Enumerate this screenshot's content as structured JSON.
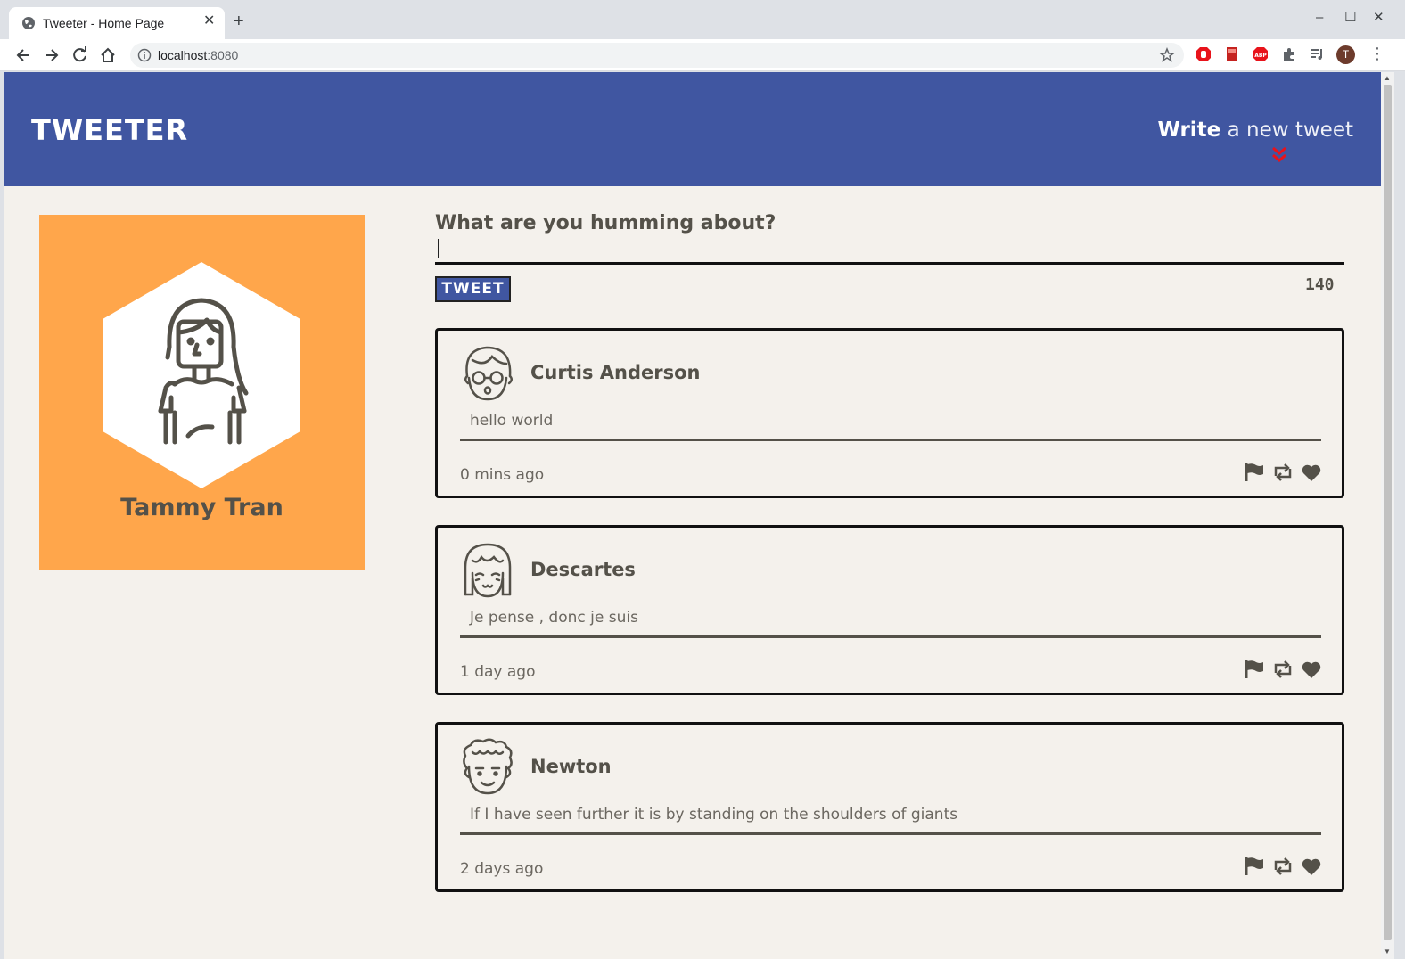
{
  "browser": {
    "tab_title": "Tweeter - Home Page",
    "tab_close": "✕",
    "new_tab": "+",
    "url_host": "localhost",
    "url_port": ":8080",
    "window_controls": [
      "–",
      "☐",
      "✕"
    ],
    "profile_initial": "T",
    "menu": "⋮"
  },
  "site": {
    "brand": "TWEETER",
    "compose_toggle_bold": "Write",
    "compose_toggle_rest": " a new tweet",
    "accent_color": "#4056a1",
    "chevron_color": "#e8131b"
  },
  "profile": {
    "name": "Tammy Tran",
    "bg_color": "#ffa64b"
  },
  "compose": {
    "label": "What are you humming about?",
    "button_label": "TWEET",
    "counter": "140"
  },
  "tweets": [
    {
      "name": "Curtis Anderson",
      "text": "hello world",
      "time": "0 mins ago",
      "avatar_icon": "glasses-boy-icon"
    },
    {
      "name": "Descartes",
      "text": "Je pense , donc je suis",
      "time": "1 day ago",
      "avatar_icon": "bob-hair-girl-icon"
    },
    {
      "name": "Newton",
      "text": "If I have seen further it is by standing on the shoulders of giants",
      "time": "2 days ago",
      "avatar_icon": "curly-hair-man-icon"
    }
  ],
  "tweet_actions": [
    "flag-icon",
    "retweet-icon",
    "heart-icon"
  ]
}
